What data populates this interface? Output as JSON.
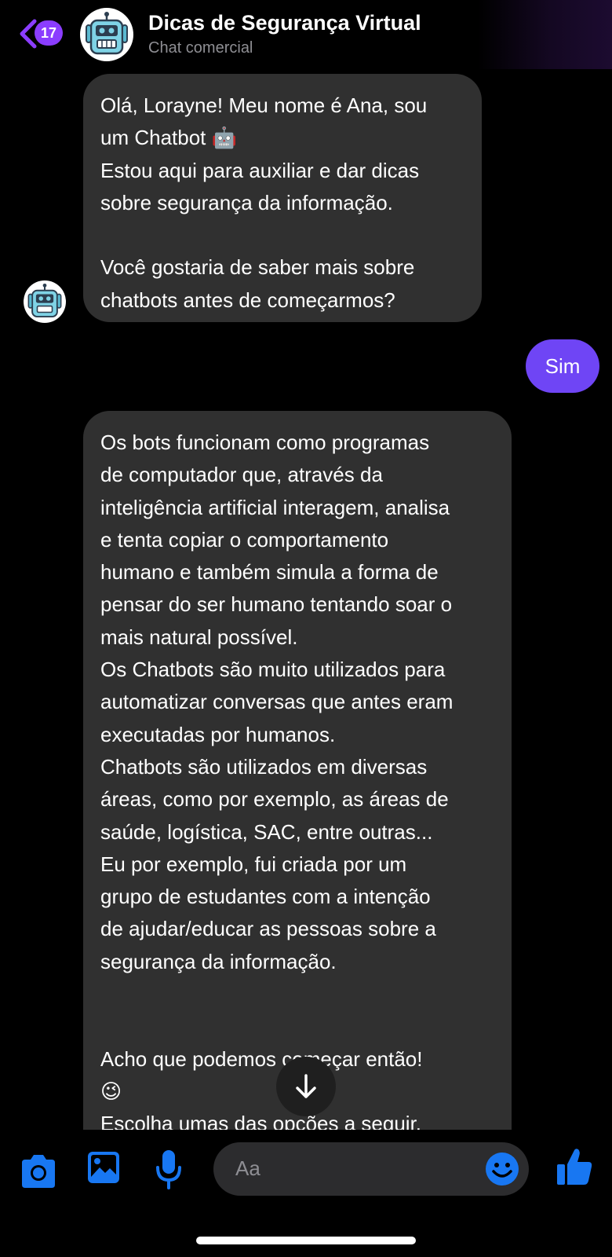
{
  "header": {
    "back_count": "17",
    "title": "Dicas de Segurança Virtual",
    "subtitle": "Chat comercial"
  },
  "messages": [
    {
      "sender": "bot",
      "text": "Olá, Lorayne! Meu nome é Ana, sou\num Chatbot 🤖\nEstou aqui para auxiliar e dar dicas\nsobre segurança da informação.\n\nVocê gostaria de saber mais sobre\nchatbots antes de começarmos?"
    },
    {
      "sender": "user",
      "text": "Sim"
    },
    {
      "sender": "bot",
      "text": "Os bots funcionam como programas\nde computador que, através da\ninteligência artificial interagem, analisa\ne tenta copiar o comportamento\nhumano e também simula a forma de\npensar do ser humano tentando soar o\nmais natural possível.\nOs Chatbots são muito utilizados para\nautomatizar conversas que antes eram\nexecutadas por humanos.\nChatbots são utilizados em diversas\náreas, como por exemplo, as áreas de\nsaúde, logística, SAC, entre outras...\nEu por exemplo, fui criada por um\ngrupo de estudantes com a intenção\nde ajudar/educar as pessoas sobre a\nsegurança da informação.\n\n\nAcho que podemos começar então!\n😉\nEscolha umas das opções a seguir."
    }
  ],
  "composer": {
    "placeholder": "Aa"
  },
  "colors": {
    "accent": "#8b3dff",
    "user_bubble": "#6f45f5",
    "bot_bubble": "#303030",
    "icon_blue": "#1877f2"
  },
  "icons": [
    "chevron-left-icon",
    "robot-avatar-icon",
    "arrow-down-icon",
    "camera-icon",
    "image-icon",
    "microphone-icon",
    "smiley-icon",
    "thumbs-up-icon"
  ]
}
